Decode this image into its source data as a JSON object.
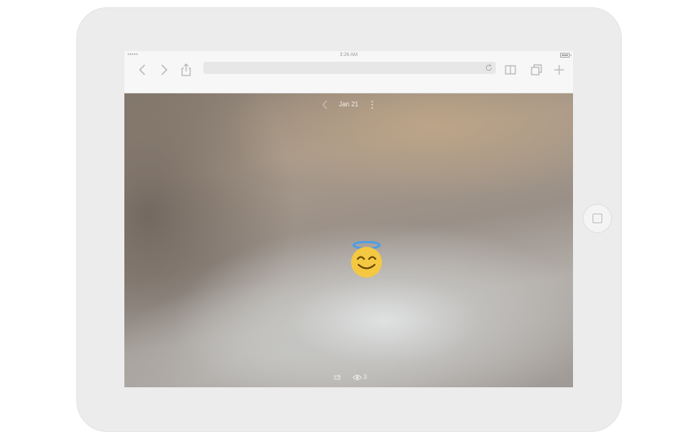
{
  "device": {
    "type": "tablet"
  },
  "statusbar": {
    "carrier": "•••••",
    "time": "3:26 AM",
    "battery_level": 1.0
  },
  "browser_toolbar": {
    "icons": [
      "back-icon",
      "forward-icon",
      "share-icon",
      "reload-icon",
      "bookmarks-icon",
      "tabs-icon",
      "new-tab-icon"
    ],
    "url": ""
  },
  "story": {
    "date": "Jan 21",
    "emoji": "smiling-face-with-halo",
    "views": "3",
    "colors": {
      "halo": "#4a9ee8",
      "face": "#f5c842"
    }
  }
}
